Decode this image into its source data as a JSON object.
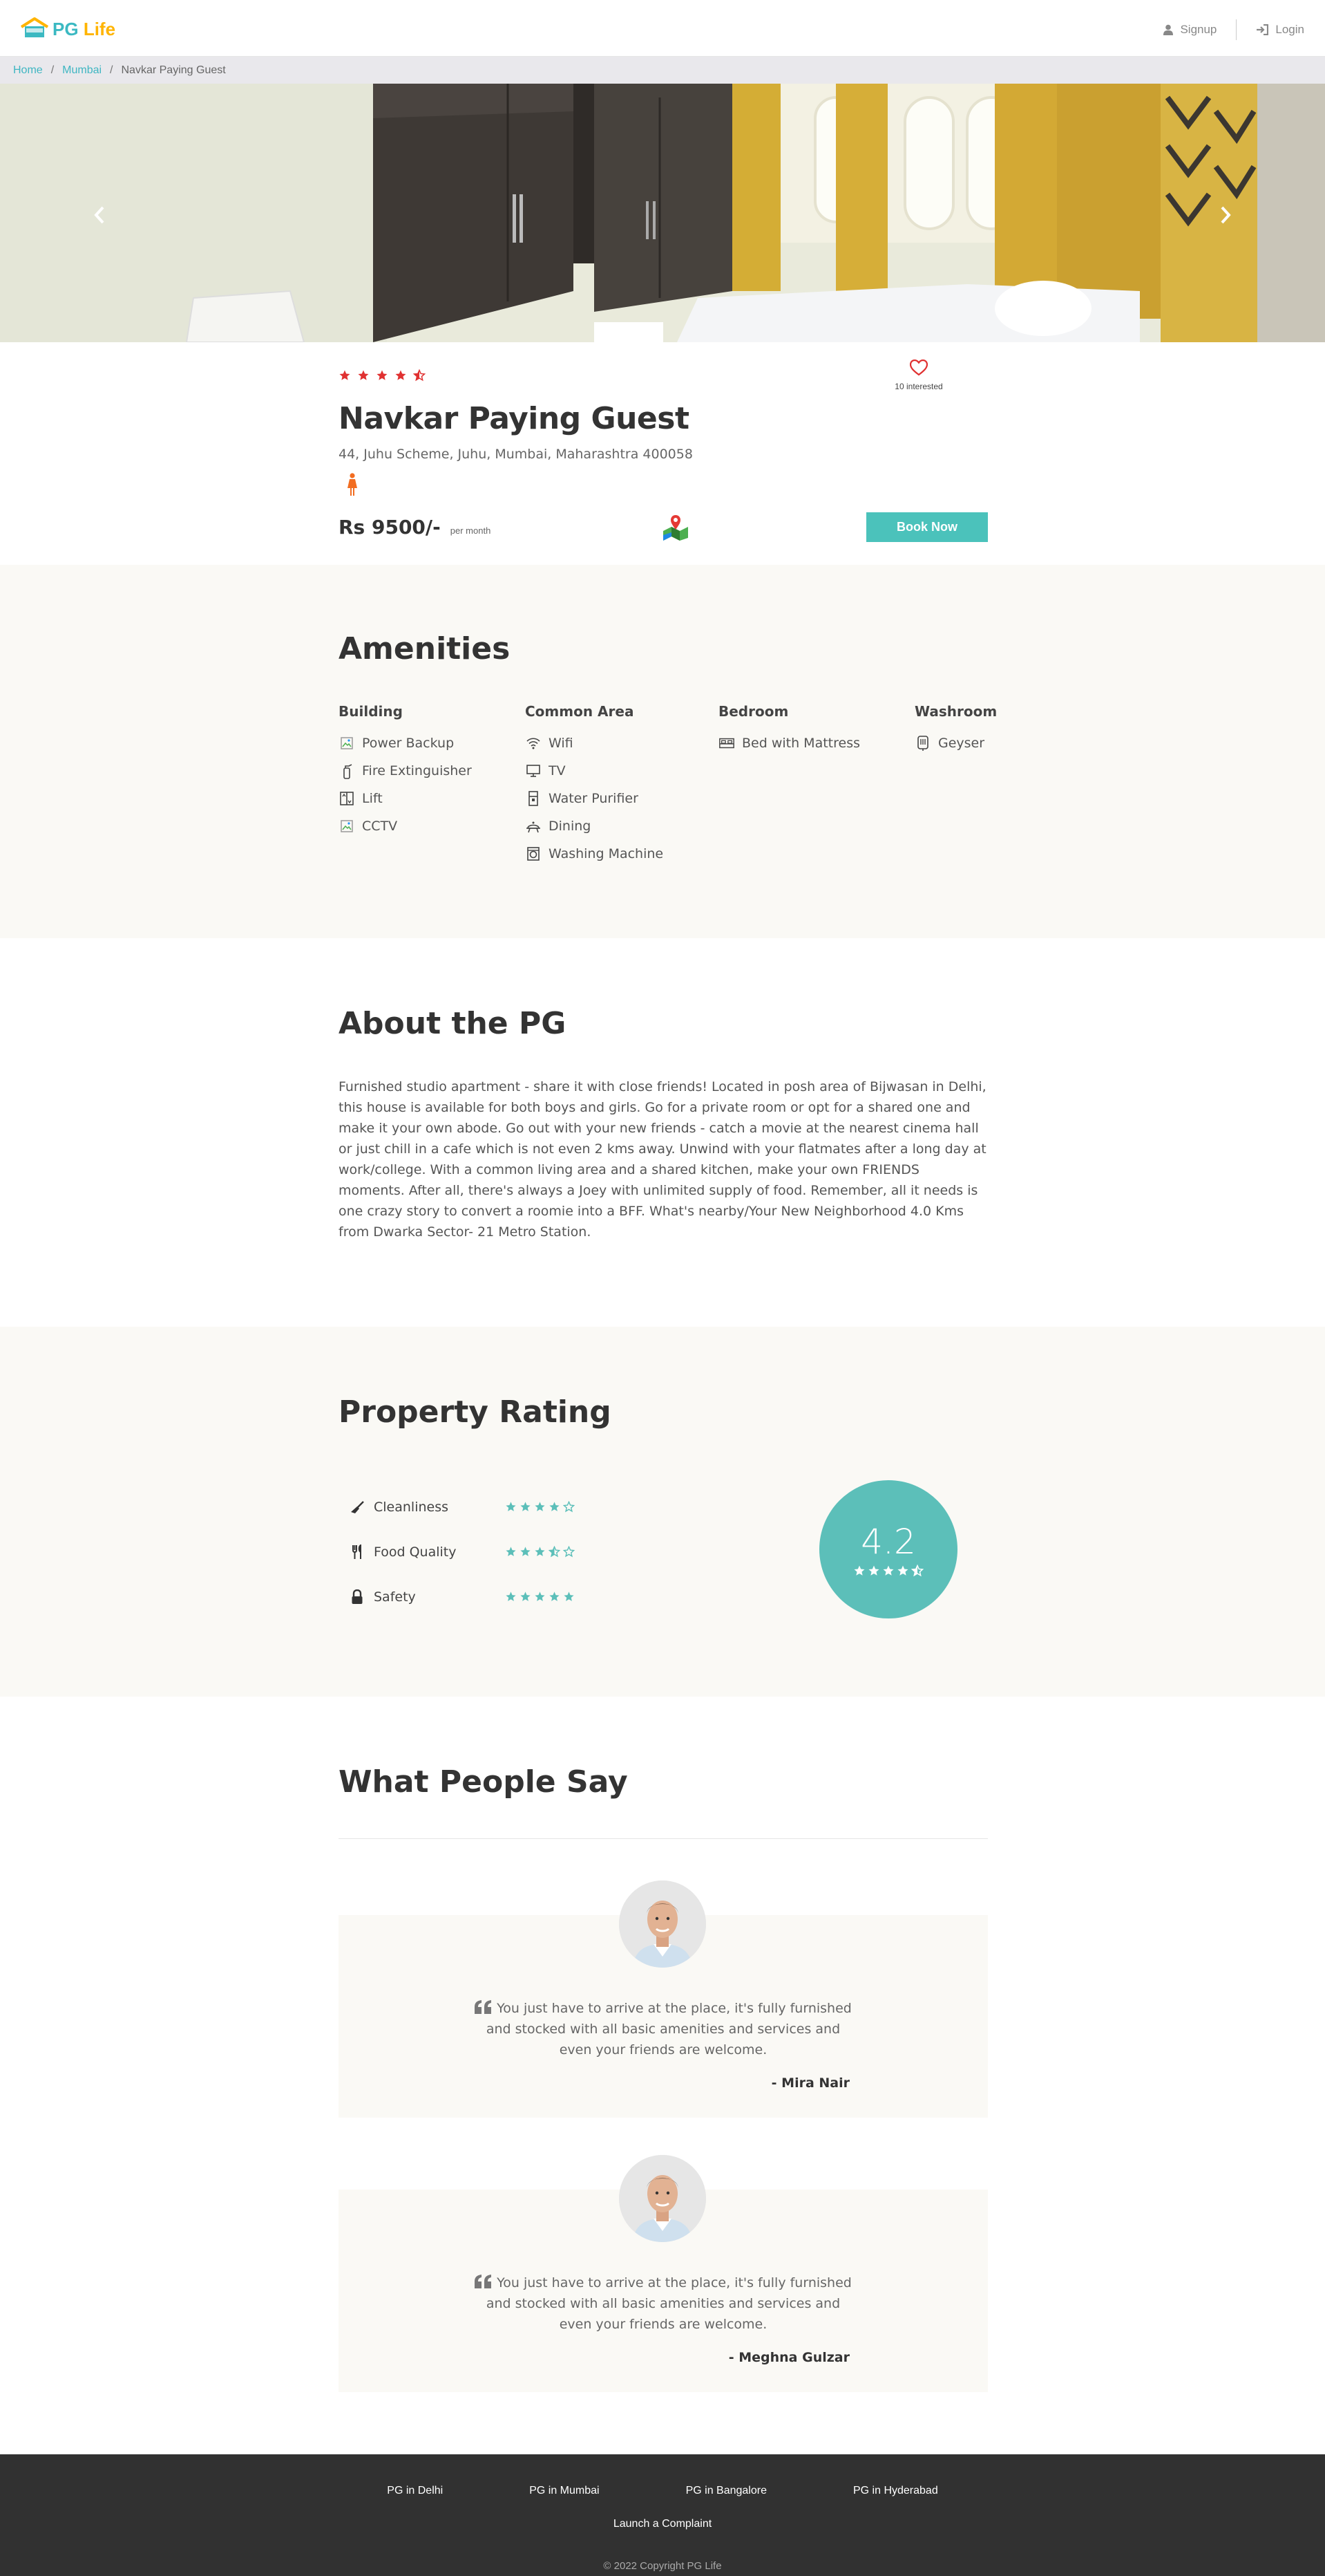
{
  "header": {
    "logo_pg": "PG",
    "logo_life": "Life",
    "signup_label": "Signup",
    "login_label": "Login"
  },
  "breadcrumb": {
    "home": "Home",
    "city": "Mumbai",
    "current": "Navkar Paying Guest",
    "separator": "/"
  },
  "property": {
    "rating_stars": 4.5,
    "interested_count": "10 interested",
    "name": "Navkar Paying Guest",
    "address": "44, Juhu Scheme, Juhu, Mumbai, Maharashtra 400058",
    "gender": "female",
    "price": "Rs 9500/-",
    "price_unit": "per month",
    "book_label": "Book Now"
  },
  "amenities": {
    "title": "Amenities",
    "groups": [
      {
        "heading": "Building",
        "items": [
          {
            "label": "Power Backup",
            "icon": "broken-image-icon"
          },
          {
            "label": "Fire Extinguisher",
            "icon": "fire-extinguisher-icon"
          },
          {
            "label": "Lift",
            "icon": "lift-icon"
          },
          {
            "label": "CCTV",
            "icon": "broken-image-icon"
          }
        ]
      },
      {
        "heading": "Common Area",
        "items": [
          {
            "label": "Wifi",
            "icon": "wifi-icon"
          },
          {
            "label": "TV",
            "icon": "tv-icon"
          },
          {
            "label": "Water Purifier",
            "icon": "water-purifier-icon"
          },
          {
            "label": "Dining",
            "icon": "dining-icon"
          },
          {
            "label": "Washing Machine",
            "icon": "washing-machine-icon"
          }
        ]
      },
      {
        "heading": "Bedroom",
        "items": [
          {
            "label": "Bed with Mattress",
            "icon": "bed-icon"
          }
        ]
      },
      {
        "heading": "Washroom",
        "items": [
          {
            "label": "Geyser",
            "icon": "geyser-icon"
          }
        ]
      }
    ]
  },
  "about": {
    "title": "About the PG",
    "text": "Furnished studio apartment - share it with close friends! Located in posh area of Bijwasan in Delhi, this house is available for both boys and girls. Go for a private room or opt for a shared one and make it your own abode. Go out with your new friends - catch a movie at the nearest cinema hall or just chill in a cafe which is not even 2 kms away. Unwind with your flatmates after a long day at work/college. With a common living area and a shared kitchen, make your own FRIENDS moments. After all, there's always a Joey with unlimited supply of food. Remember, all it needs is one crazy story to convert a roomie into a BFF. What's nearby/Your New Neighborhood 4.0 Kms from Dwarka Sector- 21 Metro Station."
  },
  "rating": {
    "title": "Property Rating",
    "overall": "4.2",
    "overall_stars": 4.5,
    "items": [
      {
        "label": "Cleanliness",
        "stars": 4,
        "icon": "broom-icon"
      },
      {
        "label": "Food Quality",
        "stars": 3.5,
        "icon": "utensils-icon"
      },
      {
        "label": "Safety",
        "stars": 5,
        "icon": "lock-icon"
      }
    ]
  },
  "testimonials": {
    "title": "What People Say",
    "items": [
      {
        "quote": "You just have to arrive at the place, it's fully furnished and stocked with all basic amenities and services and even your friends are welcome.",
        "author": "- Mira Nair"
      },
      {
        "quote": "You just have to arrive at the place, it's fully furnished and stocked with all basic amenities and services and even your friends are welcome.",
        "author": "- Meghna Gulzar"
      }
    ]
  },
  "footer": {
    "links": [
      "PG in Delhi",
      "PG in Mumbai",
      "PG in Bangalore",
      "PG in Hyderabad"
    ],
    "complaint": "Launch a Complaint",
    "copyright": "© 2022 Copyright PG Life"
  },
  "colors": {
    "accent": "#4bc2bb",
    "star_red": "#e03131",
    "star_teal": "#5cbfb9",
    "logo_orange": "#ffb400"
  }
}
